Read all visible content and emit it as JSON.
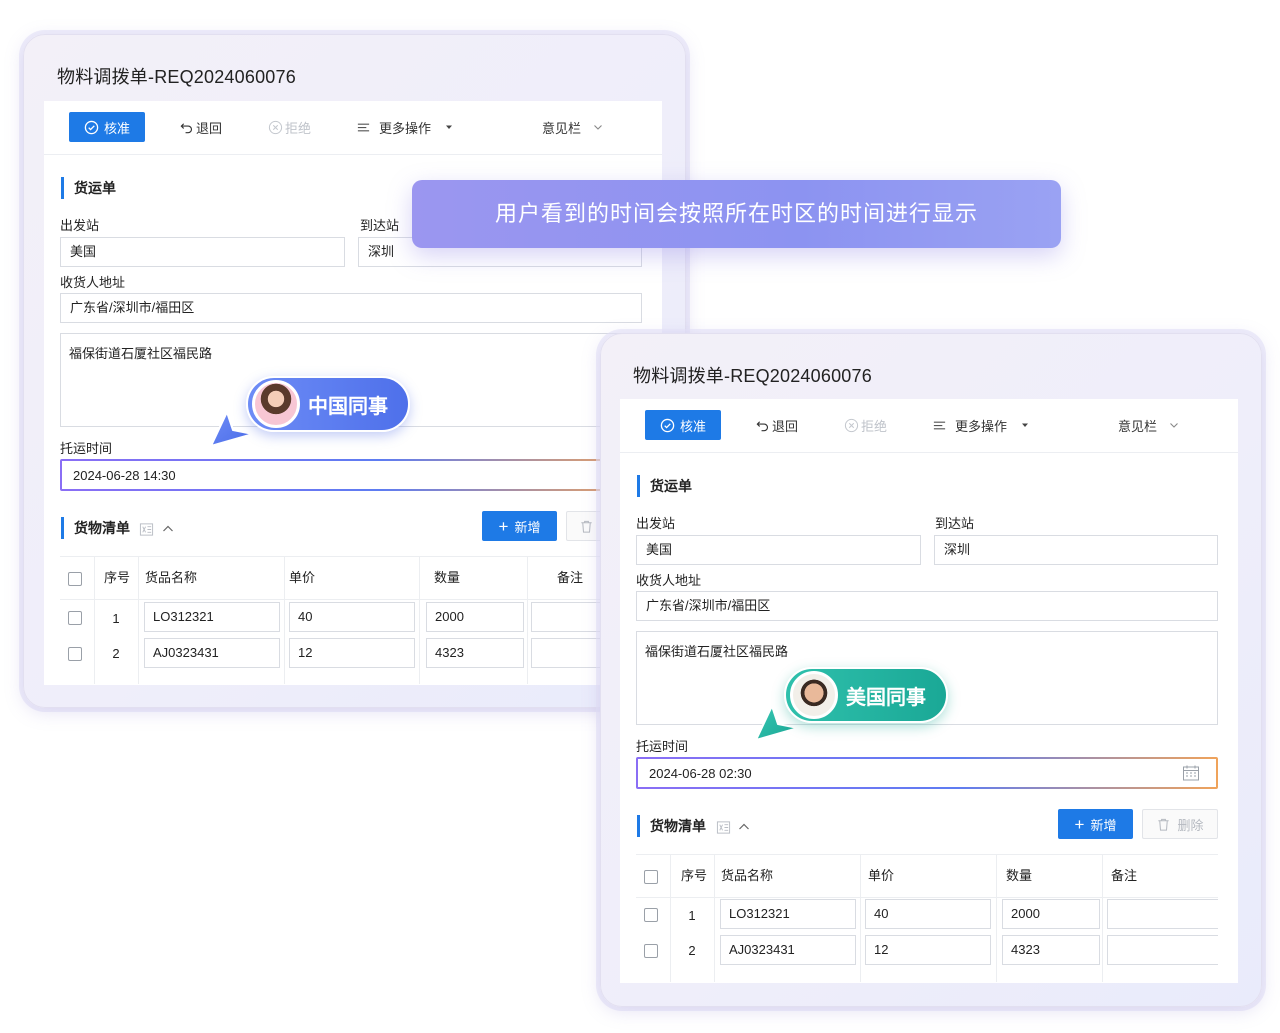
{
  "banner": {
    "text": "用户看到的时间会按照所在时区的时间进行显示"
  },
  "forms": [
    {
      "title": "物料调拨单-REQ2024060076",
      "toolbar": {
        "approve": "核准",
        "return": "退回",
        "reject": "拒绝",
        "more": "更多操作",
        "opinion": "意见栏"
      },
      "section_shipment": "货运单",
      "origin_label": "出发站",
      "origin_value": "美国",
      "dest_label": "到达站",
      "dest_value": "深圳",
      "address_label": "收货人地址",
      "address_value": "广东省/深圳市/福田区",
      "address_detail": "福保街道石厦社区福民路",
      "ship_time_label": "托运时间",
      "ship_time_value": "2024-06-28 14:30",
      "section_goods": "货物清单",
      "add_label": "新增",
      "delete_label": "删除",
      "table_headers": [
        "序号",
        "货品名称",
        "单价",
        "数量",
        "备注"
      ],
      "rows": [
        {
          "no": "1",
          "name": "LO312321",
          "price": "40",
          "qty": "2000",
          "note": ""
        },
        {
          "no": "2",
          "name": "AJ0323431",
          "price": "12",
          "qty": "4323",
          "note": ""
        }
      ],
      "colleague": "中国同事",
      "bubble_color": "#5a7cf0"
    },
    {
      "title": "物料调拨单-REQ2024060076",
      "toolbar": {
        "approve": "核准",
        "return": "退回",
        "reject": "拒绝",
        "more": "更多操作",
        "opinion": "意见栏"
      },
      "section_shipment": "货运单",
      "origin_label": "出发站",
      "origin_value": "美国",
      "dest_label": "到达站",
      "dest_value": "深圳",
      "address_label": "收货人地址",
      "address_value": "广东省/深圳市/福田区",
      "address_detail": "福保街道石厦社区福民路",
      "ship_time_label": "托运时间",
      "ship_time_value": "2024-06-28 02:30",
      "section_goods": "货物清单",
      "add_label": "新增",
      "delete_label": "删除",
      "table_headers": [
        "序号",
        "货品名称",
        "单价",
        "数量",
        "备注"
      ],
      "rows": [
        {
          "no": "1",
          "name": "LO312321",
          "price": "40",
          "qty": "2000",
          "note": ""
        },
        {
          "no": "2",
          "name": "AJ0323431",
          "price": "12",
          "qty": "4323",
          "note": ""
        }
      ],
      "colleague": "美国同事",
      "bubble_color": "#22b5a2"
    }
  ],
  "colors": {
    "primary": "#1e7ae6",
    "banner": "#9b96f0",
    "cn_bubble": "#5a7cf0",
    "us_bubble": "#22b5a2"
  }
}
